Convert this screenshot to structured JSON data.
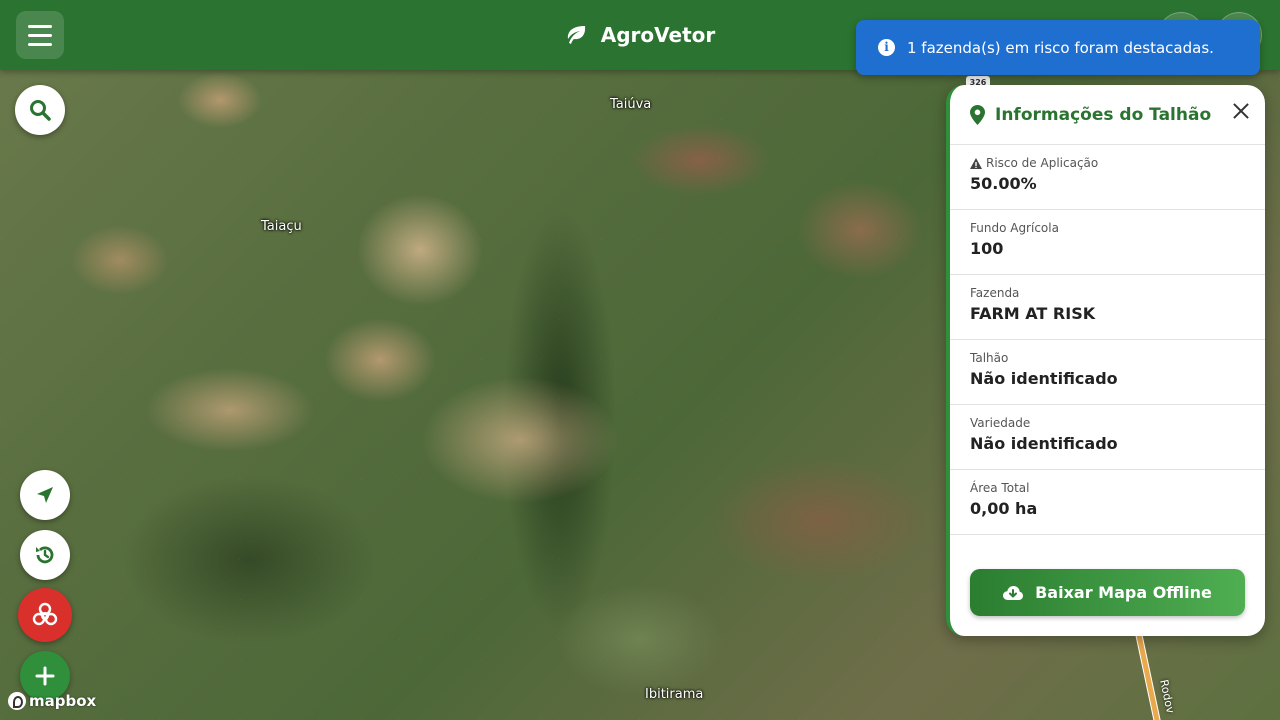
{
  "header": {
    "title": "AgroVetor"
  },
  "toast": {
    "message": "1 fazenda(s) em risco foram destacadas."
  },
  "map": {
    "labels": {
      "taiuva": "Taiúva",
      "taiacu": "Taiaçu",
      "ibitirama": "Ibitirama",
      "road_shield": "326",
      "road": "Rodov"
    },
    "attribution": "mapbox"
  },
  "panel": {
    "title": "Informações do Talhão",
    "fields": [
      {
        "label": "Risco de Aplicação",
        "value": "50.00%"
      },
      {
        "label": "Fundo Agrícola",
        "value": "100"
      },
      {
        "label": "Fazenda",
        "value": "FARM AT RISK"
      },
      {
        "label": "Talhão",
        "value": "Não identificado"
      },
      {
        "label": "Variedade",
        "value": "Não identificado"
      },
      {
        "label": "Área Total",
        "value": "0,00 ha"
      }
    ],
    "download_label": "Baixar Mapa Offline"
  },
  "colors": {
    "brand_green": "#2b7330",
    "toast_blue": "#1f6fd1",
    "danger_red": "#d9302b"
  },
  "icons": {
    "menu": "hamburger-icon",
    "brand": "leaf-icon",
    "toast": "info-icon",
    "search": "search-icon",
    "locate": "location-arrow-icon",
    "history": "history-icon",
    "biohazard": "biohazard-icon",
    "add": "plus-icon",
    "panel": "map-pin-icon",
    "close": "close-icon",
    "download": "cloud-download-icon",
    "risk": "warning-icon"
  }
}
